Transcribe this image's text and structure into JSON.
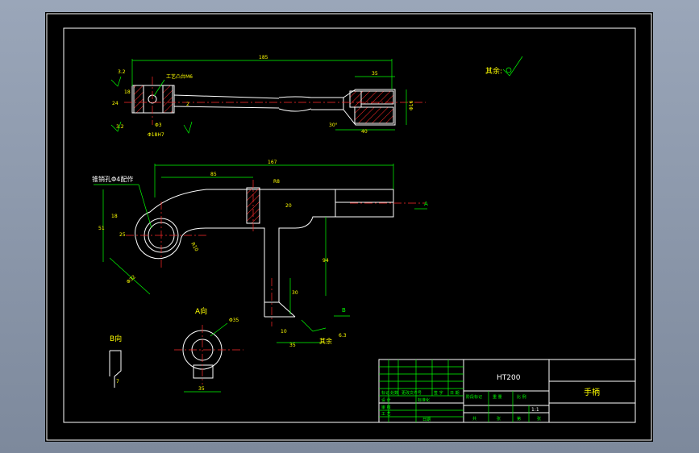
{
  "title_block": {
    "material": "HT200",
    "part_name": "手柄",
    "scale": "1:1",
    "row_labels": [
      "标记",
      "处数",
      "更改文件号",
      "签 字",
      "日 期"
    ],
    "lower_labels": [
      "设 计",
      "标准化",
      "审 核",
      "工 艺",
      "日期"
    ],
    "right_labels": [
      "阶段标记",
      "重 量",
      "比 例"
    ],
    "bottom_labels": [
      "共",
      "张",
      "第",
      "张"
    ]
  },
  "notes": {
    "roughness_rest": "其余:",
    "taper_pin_hole": "锥销孔Φ4配作",
    "process_boss": "工艺凸台M6"
  },
  "views": {
    "view_a": "A向",
    "view_b": "B向",
    "section_a": "A",
    "section_b": "B"
  },
  "dimensions": {
    "top_overall": "185",
    "top_right_bore": "35",
    "top_right_len": "40",
    "top_diam": "Φ16",
    "top_angle": "30°",
    "top_small_diam": "Φ18H7",
    "top_left_rough": "3.2",
    "top_left_rough2": "3.2",
    "top_width": "24",
    "top_left_h": "18",
    "top_chamfer": "2",
    "top_pin": "Φ3",
    "front_overall": "167",
    "front_mid": "85",
    "front_r": "R8",
    "front_h20": "20",
    "front_h51": "51",
    "front_r18": "18",
    "front_r25": "25",
    "front_r10": "R10",
    "front_d32": "Φ32",
    "front_h94": "94",
    "front_v30": "30",
    "front_w35": "35",
    "front_w10": "10",
    "front_rough": "6.3",
    "front_rest": "其余",
    "a_diam": "Φ35",
    "a_width": "35",
    "b_dim": "7"
  }
}
